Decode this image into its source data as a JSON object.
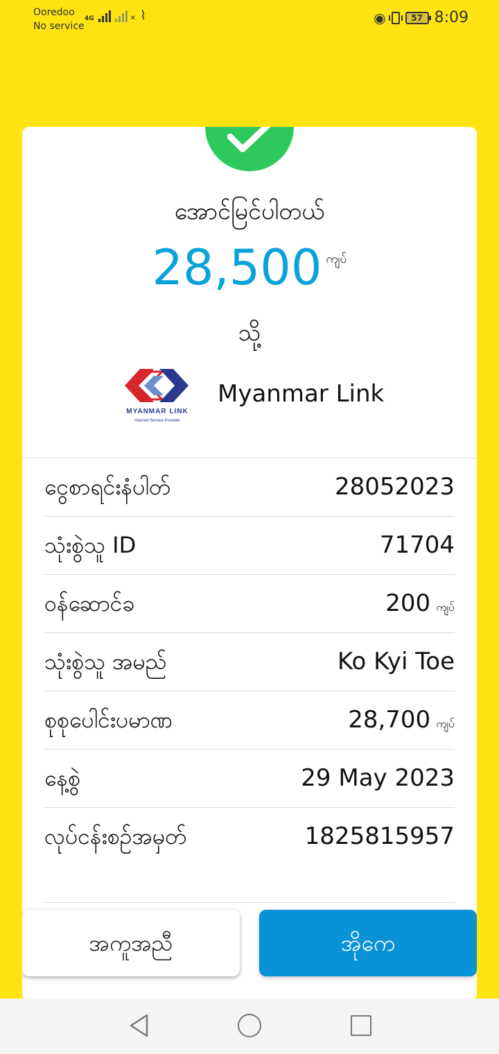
{
  "status_bar": {
    "carrier": "Ooredoo",
    "service": "No service",
    "network_type": "4G",
    "battery": "57",
    "time": "8:09"
  },
  "receipt": {
    "title": "အောင်မြင်ပါတယ်",
    "amount": "28,500",
    "amount_unit": "ကျပ်",
    "to_label": "သို့",
    "provider": "Myanmar Link",
    "logo_text": "MYANMAR LINK",
    "logo_subtext": "Internet Service Provider"
  },
  "details": [
    {
      "label": "ငွေစာရင်းနံပါတ်",
      "value": "28052023",
      "unit": ""
    },
    {
      "label": "သုံးစွဲသူ ID",
      "value": "71704",
      "unit": ""
    },
    {
      "label": "ဝန်ဆောင်ခ",
      "value": "200",
      "unit": "ကျပ်"
    },
    {
      "label": "သုံးစွဲသူ အမည်",
      "value": "Ko Kyi Toe",
      "unit": ""
    },
    {
      "label": "စုစုပေါင်းပမာဏ",
      "value": "28,700",
      "unit": "ကျပ်"
    },
    {
      "label": "နေ့စွဲ",
      "value": "29 May 2023",
      "unit": ""
    },
    {
      "label": "လုပ်ငန်းစဉ်အမှတ်",
      "value": "1825815957",
      "unit": ""
    }
  ],
  "buttons": {
    "help": "အကူအညီ",
    "ok": "အိုကေ"
  },
  "colors": {
    "background": "#FFE411",
    "success": "#2EC95C",
    "amount": "#0AA3D9",
    "primary_button": "#0992D6"
  }
}
